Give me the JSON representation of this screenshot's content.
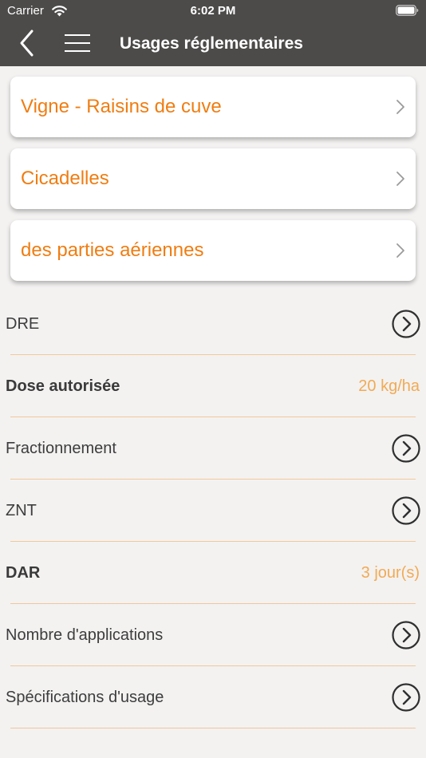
{
  "status_bar": {
    "carrier": "Carrier",
    "time": "6:02 PM"
  },
  "nav_bar": {
    "title": "Usages réglementaires",
    "back_icon": "chevron-left-icon",
    "menu_icon": "hamburger-menu-icon"
  },
  "cards": [
    {
      "label": "Vigne - Raisins de cuve"
    },
    {
      "label": "Cicadelles"
    },
    {
      "label": "des parties aériennes"
    }
  ],
  "rows": {
    "dre": {
      "label": "DRE"
    },
    "dose": {
      "label": "Dose autorisée",
      "value": "20 kg/ha"
    },
    "fractionnement": {
      "label": "Fractionnement"
    },
    "znt": {
      "label": "ZNT"
    },
    "dar": {
      "label": "DAR",
      "value": "3 jour(s)"
    },
    "nombre_applications": {
      "label": "Nombre d'applications"
    },
    "specifications": {
      "label": "Spécifications d'usage"
    }
  },
  "colors": {
    "header_bg": "#4d4b4a",
    "accent": "#ef7d12",
    "value_text": "#f2aa54",
    "separator": "#f3c79a",
    "background": "#f3f2f1"
  }
}
